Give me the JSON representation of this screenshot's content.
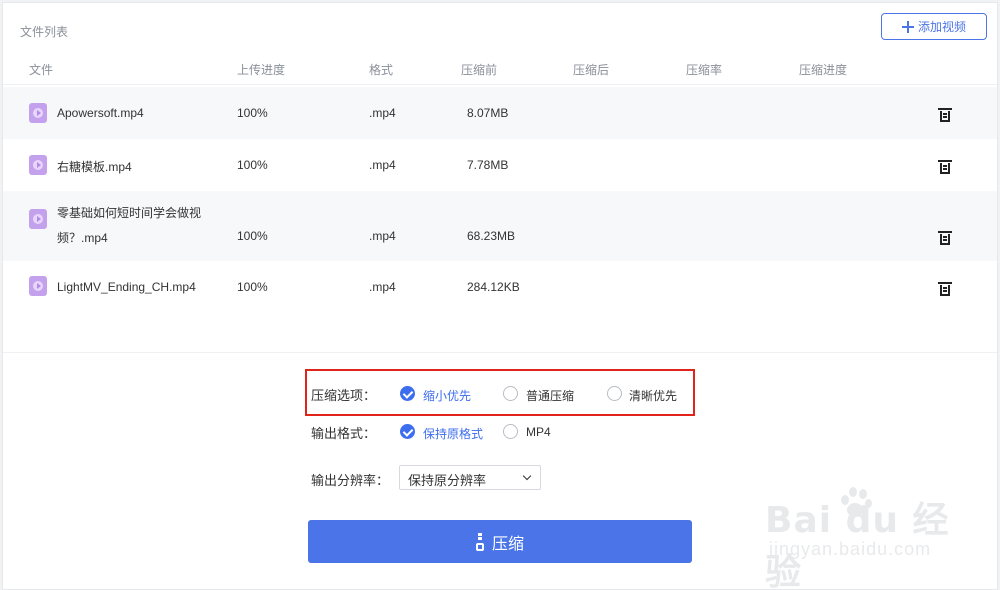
{
  "file_list": {
    "title": "文件列表",
    "add_button_label": "添加视频",
    "columns": [
      "文件",
      "上传进度",
      "格式",
      "压缩前",
      "压缩后",
      "压缩率",
      "压缩进度"
    ],
    "rows": [
      {
        "name": "Apowersoft.mp4",
        "name_line2": "",
        "progress": "100%",
        "format": ".mp4",
        "size_before": "8.07MB",
        "size_after": "",
        "ratio": "",
        "compress_progress": ""
      },
      {
        "name": "右糖模板.mp4",
        "name_line2": "",
        "progress": "100%",
        "format": ".mp4",
        "size_before": "7.78MB",
        "size_after": "",
        "ratio": "",
        "compress_progress": ""
      },
      {
        "name": "零基础如何短时间学会做视",
        "name_line2": "频？.mp4",
        "progress": "100%",
        "format": ".mp4",
        "size_before": "68.23MB",
        "size_after": "",
        "ratio": "",
        "compress_progress": ""
      },
      {
        "name": "LightMV_Ending_CH.mp4",
        "name_line2": "",
        "progress": "100%",
        "format": ".mp4",
        "size_before": "284.12KB",
        "size_after": "",
        "ratio": "",
        "compress_progress": ""
      }
    ]
  },
  "options": {
    "compress_label": "压缩选项：",
    "compress_options": [
      "缩小优先",
      "普通压缩",
      "清晰优先"
    ],
    "compress_selected": "缩小优先",
    "format_label": "输出格式：",
    "format_options": [
      "保持原格式",
      "MP4"
    ],
    "format_selected": "保持原格式",
    "resolution_label": "输出分辨率：",
    "resolution_value": "保持原分辨率"
  },
  "compress_button_label": "压缩",
  "watermark": {
    "logo": "Bai du 经验",
    "sub": "jingyan.baidu.com"
  },
  "colors": {
    "accent": "#4a74e8",
    "highlight": "#e0231b",
    "file_icon": "#c4a1ec"
  }
}
